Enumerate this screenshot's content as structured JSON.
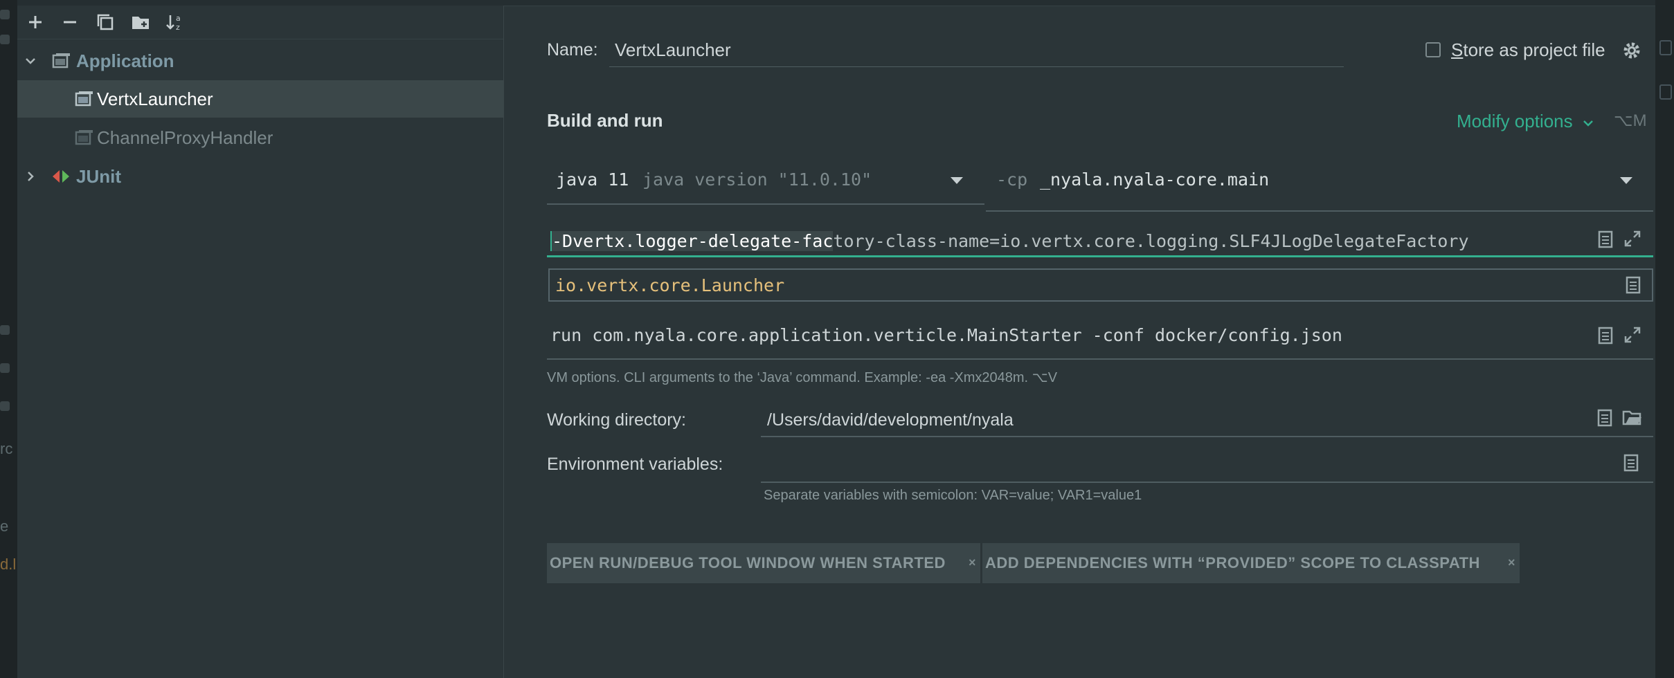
{
  "toolbar": {
    "add": "add-icon",
    "remove": "remove-icon",
    "copy": "copy-icon",
    "folder": "new-folder-icon",
    "sort": "sort-icon"
  },
  "tree": {
    "application_group": "Application",
    "items": [
      {
        "label": "VertxLauncher"
      },
      {
        "label": "ChannelProxyHandler"
      }
    ],
    "junit_group": "JUnit"
  },
  "form": {
    "name_label": "Name:",
    "name_value": "VertxLauncher",
    "store_label_prefix": "S",
    "store_label_rest": "tore as project file",
    "build_run_heading": "Build and run",
    "modify_options": "Modify options",
    "modify_shortcut": "⌥M",
    "jre": {
      "name": "java 11",
      "version": "java version \"11.0.10\""
    },
    "classpath": {
      "flag": "-cp",
      "module": "_nyala.nyala-core.main"
    },
    "vm_options_selected": "-Dvertx.logger-delegate-fac",
    "vm_options_rest": "tory-class-name=io.vertx.core.logging.SLF4JLogDelegateFactory",
    "main_class": "io.vertx.core.Launcher",
    "program_args": "run com.nyala.core.application.verticle.MainStarter -conf docker/config.json",
    "vm_hint": "VM options. CLI arguments to the ‘Java’ command. Example: -ea -Xmx2048m. ⌥V",
    "working_dir_label": "Working directory:",
    "working_dir_value": "/Users/david/development/nyala",
    "env_label": "Environment variables:",
    "env_value": "",
    "env_hint": "Separate variables with semicolon: VAR=value; VAR1=value1",
    "option_chips": [
      "OPEN RUN/DEBUG TOOL WINDOW WHEN STARTED",
      "ADD DEPENDENCIES WITH “PROVIDED” SCOPE TO CLASSPATH"
    ]
  },
  "colors": {
    "accent_teal": "#33b08f",
    "main_class_yellow": "#e5c07b",
    "junit_red": "#d9584a",
    "junit_green": "#5fb85a",
    "selection": "#3b4749"
  },
  "gutter_fragments": [
    "rc",
    "e",
    "d.l"
  ]
}
